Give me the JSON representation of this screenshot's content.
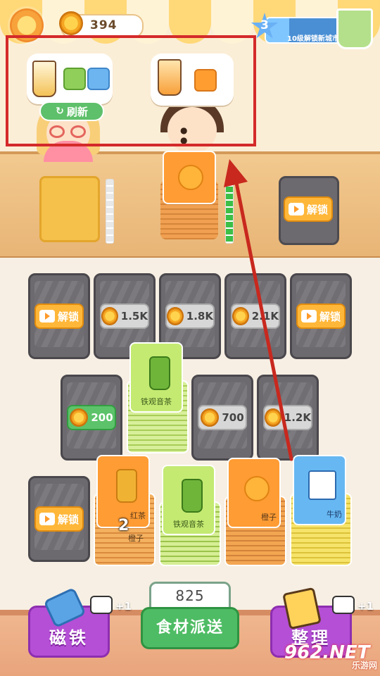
{
  "hud": {
    "coins": "394",
    "level": "3",
    "level_hint": "10级解锁新城市"
  },
  "orders": {
    "order1": {
      "icons": [
        "bubble-tea-icon",
        "green-tea-bottle-icon",
        "milk-carton-icon"
      ]
    },
    "order2": {
      "icons": [
        "orange-drink-icon",
        "orange-icon"
      ]
    },
    "refresh_label": "刷新"
  },
  "counter": {
    "slot2_card": "orange-icon",
    "unlock_label": "解锁"
  },
  "grid": {
    "row1": [
      {
        "type": "locked",
        "label": "解锁"
      },
      {
        "type": "price",
        "label": "1.5K"
      },
      {
        "type": "price",
        "label": "1.8K"
      },
      {
        "type": "price",
        "label": "2.1K"
      },
      {
        "type": "locked",
        "label": "解锁"
      }
    ],
    "row2": [
      {
        "type": "price",
        "label": "200"
      },
      {
        "type": "card",
        "label": "铁观音茶"
      },
      {
        "type": "price",
        "label": "700"
      },
      {
        "type": "price",
        "label": "1.2K"
      }
    ],
    "row3": [
      {
        "type": "locked",
        "label": "解锁"
      },
      {
        "type": "card",
        "label": "红茶",
        "sub": "橙子",
        "count": "2"
      },
      {
        "type": "card",
        "label": "铁观音茶"
      },
      {
        "type": "card",
        "label": "橙子"
      },
      {
        "type": "card",
        "label": "牛奶"
      }
    ]
  },
  "bottom": {
    "magnet_label": "磁铁",
    "magnet_plus": "+1",
    "dispatch_count": "825",
    "dispatch_label": "食材派送",
    "sort_label": "整理",
    "sort_plus": "+1"
  },
  "watermark": {
    "brand": "962.NET",
    "sub": "乐游网"
  },
  "colors": {
    "highlight_box": "#d42a2a",
    "arrow": "#c8281e"
  }
}
